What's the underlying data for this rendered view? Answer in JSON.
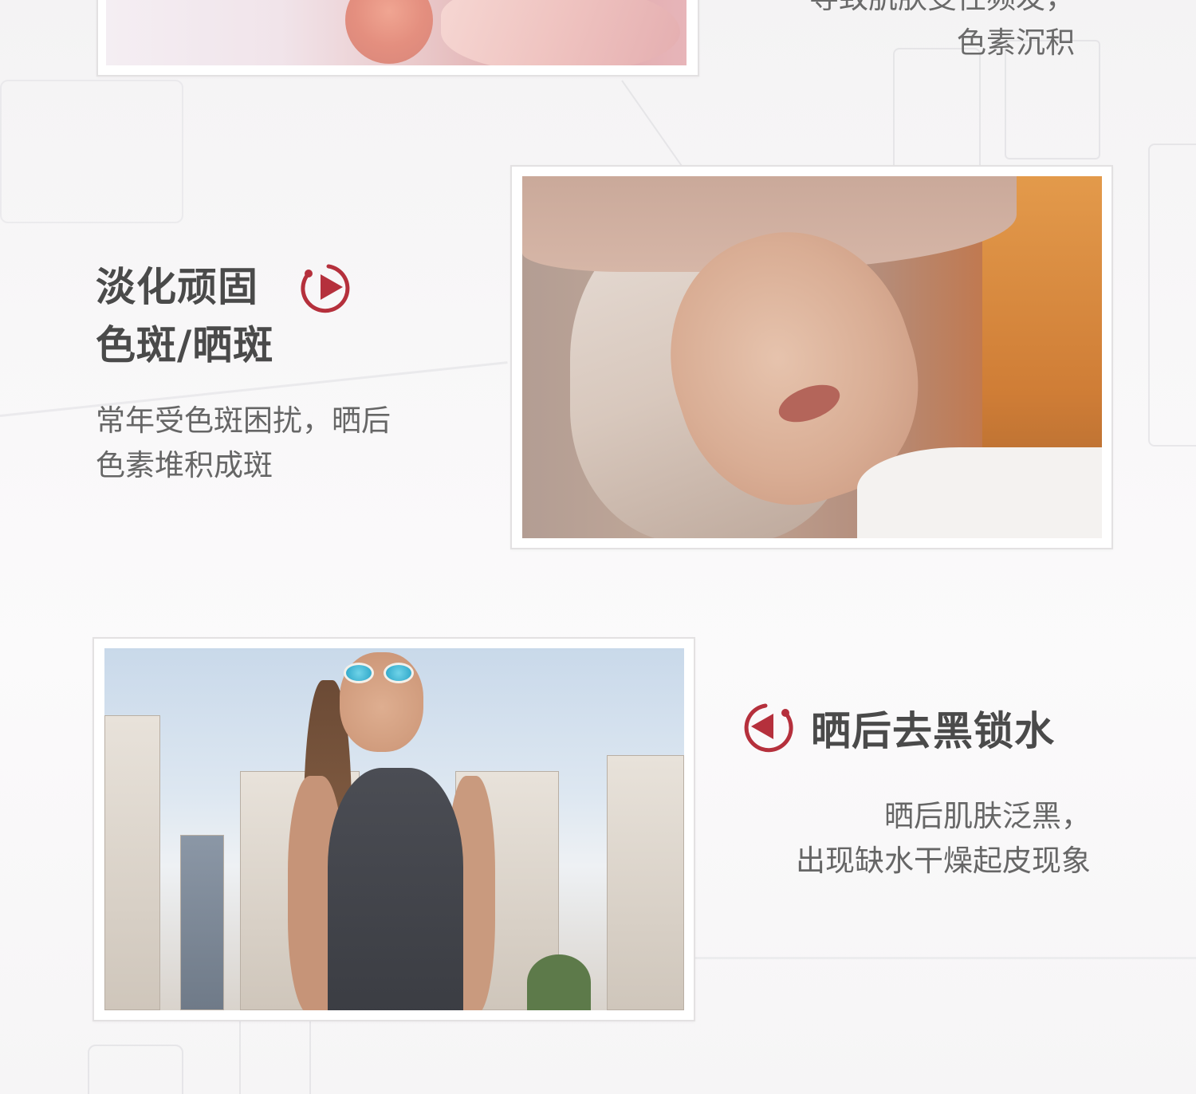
{
  "colors": {
    "accent": "#b5303c",
    "heading": "#4a4a4a",
    "body": "#666666",
    "background": "#f7f6f7"
  },
  "top_section": {
    "text_line1": "导致肌肤变性频发，",
    "text_line2": "色素沉积"
  },
  "section_spots": {
    "heading_line1": "淡化顽固",
    "heading_line2": "色斑/晒斑",
    "body_line1": "常年受色斑困扰，晒后",
    "body_line2": "色素堆积成斑",
    "icon": "circular-arrow-right-icon"
  },
  "section_aftersun": {
    "heading": "晒后去黑锁水",
    "body_line1": "晒后肌肤泛黑，",
    "body_line2": "出现缺水干燥起皮现象",
    "icon": "circular-arrow-left-icon"
  }
}
